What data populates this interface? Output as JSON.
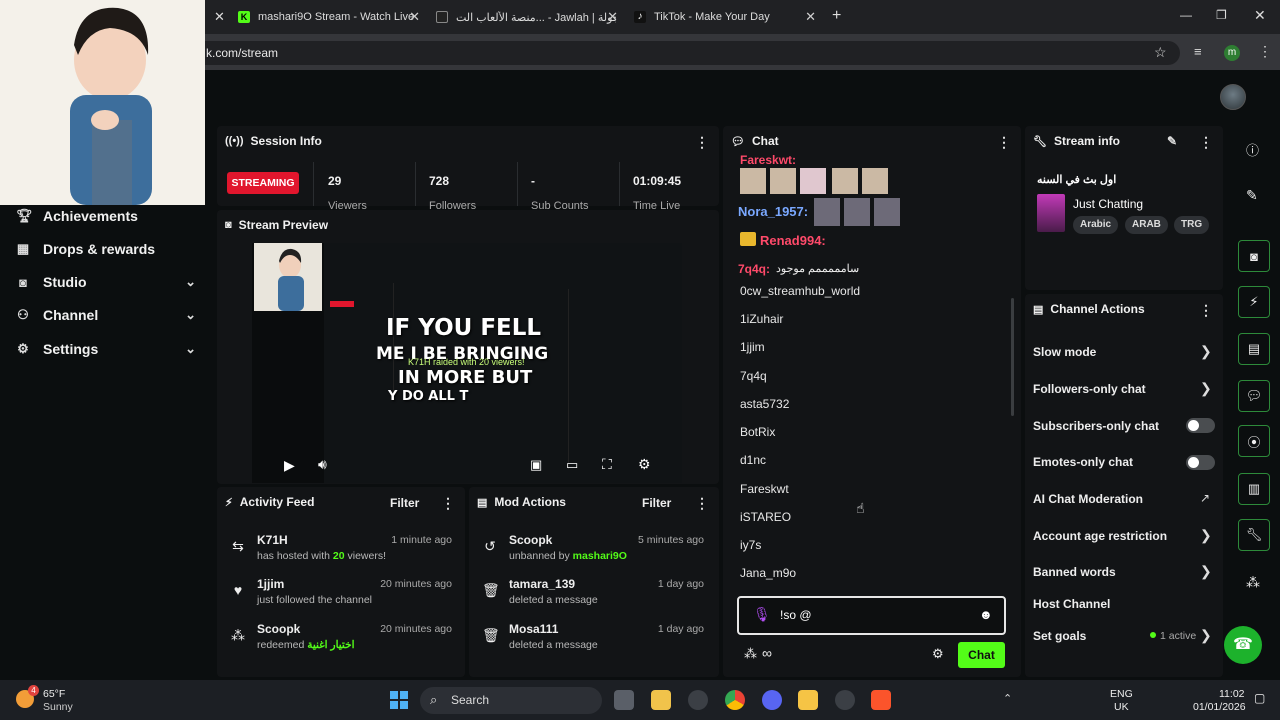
{
  "browser": {
    "tabs": [
      {
        "title": "mashari9O Stream - Watch Live"
      },
      {
        "title": "منصة الألعاب الت... - Jawlah | جولة"
      },
      {
        "title": "TikTok - Make Your Day"
      }
    ],
    "url": "k.com/stream",
    "profile_initial": "m"
  },
  "sidebar": {
    "items": [
      {
        "label": "Achievements"
      },
      {
        "label": "Drops & rewards"
      },
      {
        "label": "Studio"
      },
      {
        "label": "Channel"
      },
      {
        "label": "Settings"
      }
    ]
  },
  "session": {
    "title": "Session Info",
    "status": "STREAMING",
    "viewers": "29",
    "viewers_label": "Viewers",
    "followers": "728",
    "followers_label": "Followers",
    "subs": "-",
    "subs_label": "Sub Counts",
    "time": "01:09:45",
    "time_label": "Time Live"
  },
  "preview": {
    "title": "Stream Preview",
    "overlay_line1": "IF YOU FELL",
    "overlay_line2": "ME I BE BRINGING",
    "overlay_line3": "IN MORE BUT",
    "overlay_line4": "Y DO ALL T",
    "overlay_small": "K71H raided with 20 viewers!"
  },
  "activity": {
    "title": "Activity Feed",
    "filter": "Filter",
    "items": [
      {
        "name": "K71H",
        "desc_pre": "has hosted with ",
        "desc_hl": "20",
        "desc_post": " viewers!",
        "time": "1 minute ago"
      },
      {
        "name": "1jjim",
        "desc": "just followed the channel",
        "time": "20 minutes ago"
      },
      {
        "name": "Scoopk",
        "desc_pre": "redeemed ",
        "desc_hl": "اختيار اغنية",
        "time": "20 minutes ago"
      }
    ]
  },
  "mod": {
    "title": "Mod Actions",
    "filter": "Filter",
    "items": [
      {
        "name": "Scoopk",
        "desc_pre": "unbanned by ",
        "desc_hl": "mashari9O",
        "time": "5 minutes ago"
      },
      {
        "name": "tamara_139",
        "desc": "deleted a message",
        "time": "1 day ago"
      },
      {
        "name": "Mosa111",
        "desc": "deleted a message",
        "time": "1 day ago"
      }
    ]
  },
  "chat": {
    "title": "Chat",
    "messages": [
      {
        "user": "Fareskwt",
        "color": "#ff4a6a"
      },
      {
        "user": "Nora_1957",
        "color": "#7aa8ff"
      },
      {
        "user": "Renad994",
        "color": "#ff4a6a"
      },
      {
        "user": "7q4q",
        "color": "#ff4a6a",
        "text": "سامممممم موجود"
      }
    ],
    "mention_list": [
      "0cw_streamhub_world",
      "1iZuhair",
      "1jjim",
      "7q4q",
      "asta5732",
      "BotRix",
      "d1nc",
      "Fareskwt",
      "iSTAREO",
      "iy7s",
      "Jana_m9o"
    ],
    "input_value": "!so @",
    "send_label": "Chat"
  },
  "stream_info": {
    "title": "Stream info",
    "stream_title": "اول بث في السنه",
    "category": "Just Chatting",
    "tags": [
      "Arabic",
      "ARAB",
      "TRG"
    ]
  },
  "channel_actions": {
    "title": "Channel Actions",
    "items": [
      {
        "label": "Slow mode"
      },
      {
        "label": "Followers-only chat"
      },
      {
        "label": "Subscribers-only chat"
      },
      {
        "label": "Emotes-only chat"
      },
      {
        "label": "AI Chat Moderation"
      },
      {
        "label": "Account age restriction"
      },
      {
        "label": "Banned words"
      },
      {
        "label": "Host Channel"
      },
      {
        "label": "Set goals"
      }
    ],
    "goals_status": "1 active"
  },
  "taskbar": {
    "weather_temp": "65°F",
    "weather_desc": "Sunny",
    "weather_badge": "4",
    "search": "Search",
    "lang1": "ENG",
    "lang2": "UK",
    "time": "11:02",
    "date": "01/01/2026"
  },
  "colors": {
    "accent": "#53fc18",
    "live": "#e1162d"
  }
}
